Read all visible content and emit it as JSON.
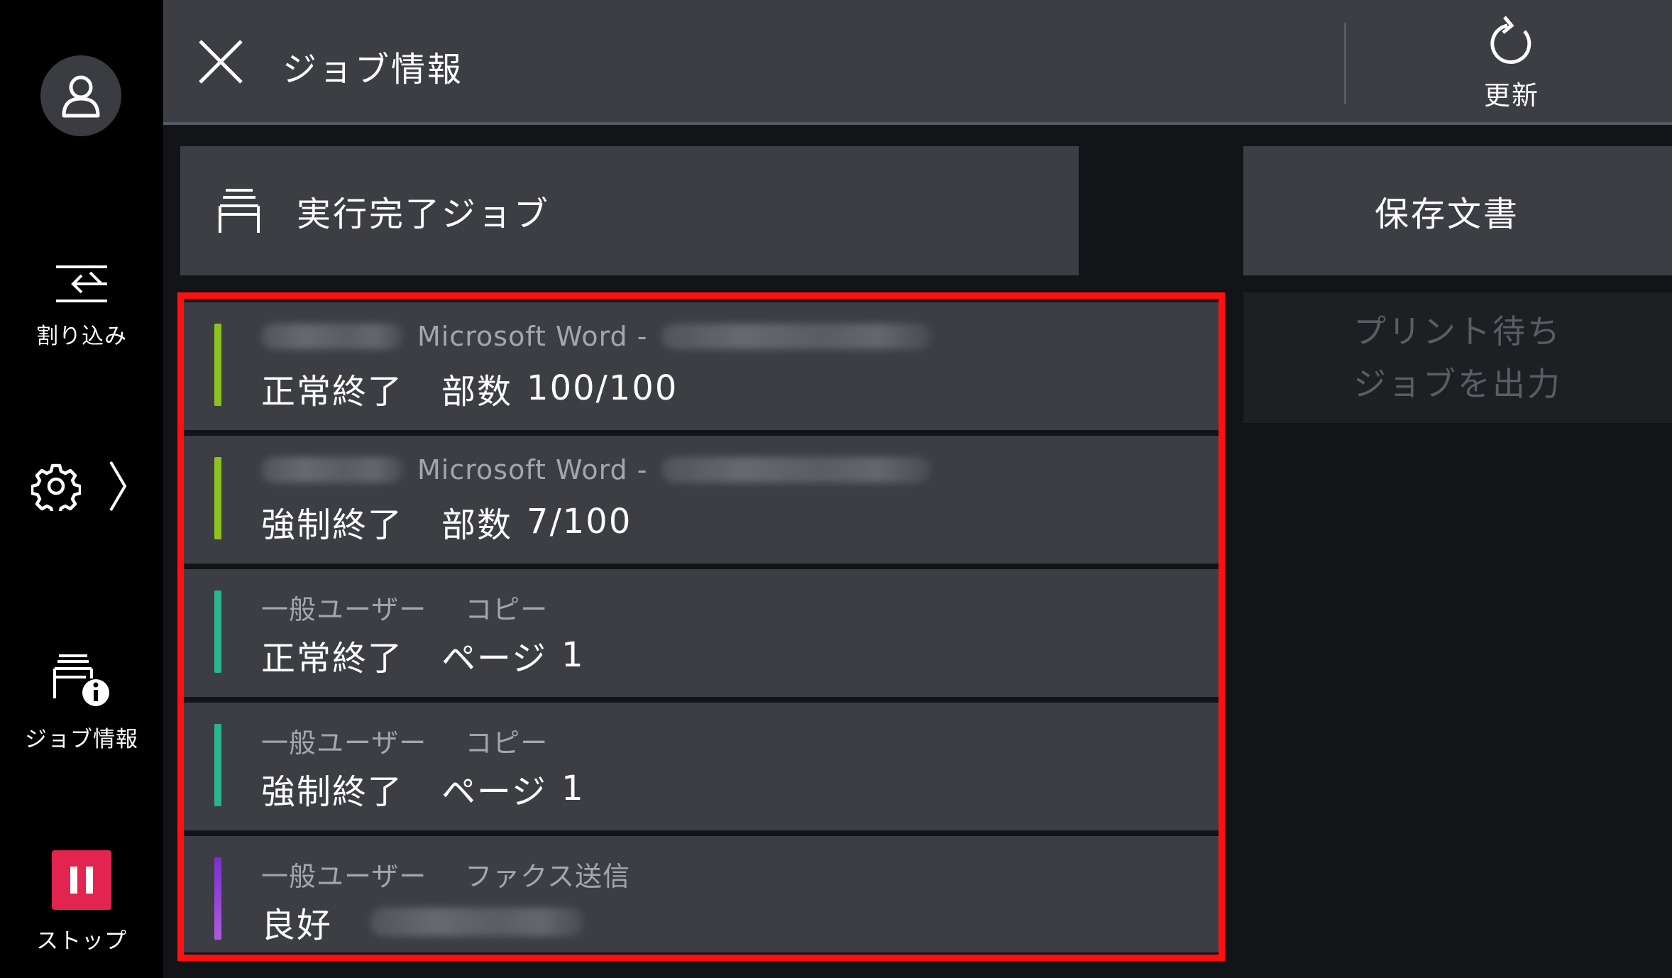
{
  "sidebar": {
    "items": [
      {
        "label": "割り込み",
        "icon": "interrupt-icon"
      },
      {
        "label": "",
        "icon": "gear-icon"
      },
      {
        "label": "ジョブ情報",
        "icon": "job-info-icon"
      },
      {
        "label": "ストップ",
        "icon": "pause-icon"
      }
    ],
    "stop_color": "#e3244f"
  },
  "header": {
    "title": "ジョブ情報",
    "refresh_label": "更新"
  },
  "tabs": {
    "completed_label": "実行完了ジョブ",
    "saved_label": "保存文書"
  },
  "print_waiting": {
    "line1": "プリント待ち",
    "line2": "ジョブを出力"
  },
  "jobs": [
    {
      "owner": "",
      "name": "Microsoft Word -",
      "status": "正常終了",
      "count_label": "部数",
      "count": "100/100",
      "bar_color": "#8dc21f"
    },
    {
      "owner": "",
      "name": "Microsoft Word -",
      "status": "強制終了",
      "count_label": "部数",
      "count": "7/100",
      "bar_color": "#8dc21f"
    },
    {
      "owner": "一般ユーザー",
      "name": "コピー",
      "status": "正常終了",
      "count_label": "ページ",
      "count": "1",
      "bar_color": "#2bb58a"
    },
    {
      "owner": "一般ユーザー",
      "name": "コピー",
      "status": "強制終了",
      "count_label": "ページ",
      "count": "1",
      "bar_color": "#2bb58a"
    },
    {
      "owner": "一般ユーザー",
      "name": "ファクス送信",
      "status": "良好",
      "count_label": "",
      "count": "",
      "bar_color": "#9a3fd6"
    }
  ],
  "highlight_color": "#ff1010"
}
